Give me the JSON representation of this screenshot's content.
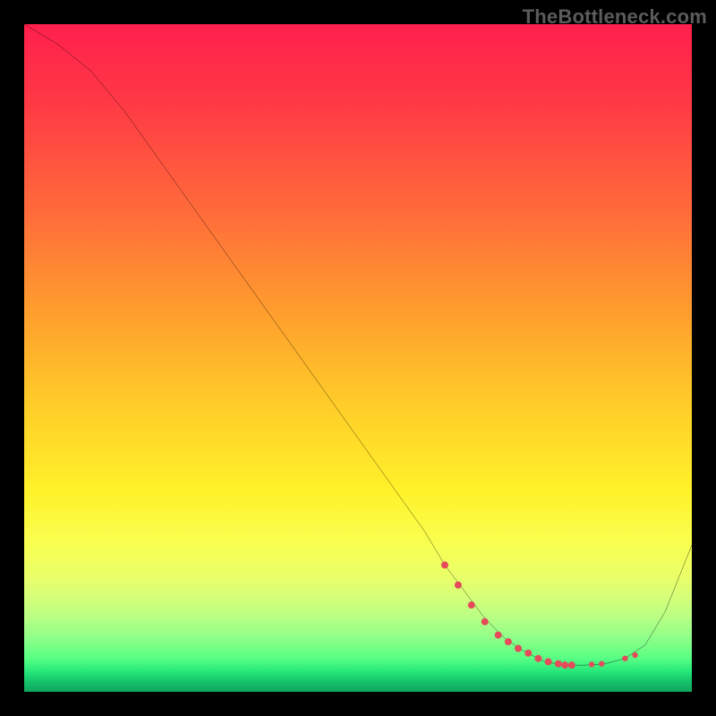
{
  "watermark": "TheBottleneck.com",
  "chart_data": {
    "type": "line",
    "title": "",
    "xlabel": "",
    "ylabel": "",
    "xlim": [
      0,
      100
    ],
    "ylim": [
      0,
      100
    ],
    "grid": false,
    "series": [
      {
        "name": "curve",
        "x": [
          0,
          5,
          10,
          15,
          20,
          25,
          30,
          35,
          40,
          45,
          50,
          55,
          60,
          63,
          66,
          69,
          72,
          75,
          78,
          81,
          84,
          87,
          90,
          93,
          96,
          100
        ],
        "y": [
          100,
          97,
          93,
          87,
          80,
          73,
          66,
          59,
          52,
          45,
          38,
          31,
          24,
          19,
          15,
          11,
          8,
          6,
          4.5,
          4,
          4,
          4.2,
          5,
          7,
          12,
          22
        ]
      }
    ],
    "scatter": {
      "name": "points",
      "color": "#e54b5b",
      "x": [
        63,
        65,
        67,
        69,
        71,
        72.5,
        74,
        75.5,
        77,
        78.5,
        80,
        81,
        82,
        85,
        86.5,
        90,
        91.5
      ],
      "y": [
        19,
        16,
        13,
        10.5,
        8.5,
        7.5,
        6.5,
        5.8,
        5,
        4.5,
        4.2,
        4,
        4,
        4.1,
        4.2,
        5,
        5.5
      ],
      "r": [
        4,
        4,
        4,
        4,
        4,
        4,
        4,
        4,
        4,
        4,
        4,
        4,
        4,
        3.2,
        3.2,
        3.2,
        3.2
      ]
    }
  }
}
